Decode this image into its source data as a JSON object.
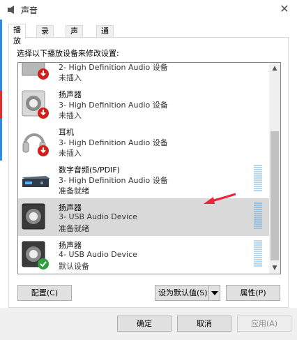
{
  "window": {
    "title": "声音"
  },
  "tabs": [
    {
      "label": "播放",
      "active": true
    },
    {
      "label": "录制",
      "active": false
    },
    {
      "label": "声音",
      "active": false
    },
    {
      "label": "通信",
      "active": false
    }
  ],
  "instruction": "选择以下播放设备来修改设置:",
  "devices": [
    {
      "name": "",
      "desc": "2- High Definition Audio 设备",
      "status": "未插入",
      "icon": "speaker-partial-icon",
      "badge": "disconnected-icon"
    },
    {
      "name": "扬声器",
      "desc": "3- High Definition Audio 设备",
      "status": "未插入",
      "icon": "speaker-icon",
      "badge": "disconnected-icon"
    },
    {
      "name": "耳机",
      "desc": "3- High Definition Audio 设备",
      "status": "未插入",
      "icon": "headphones-icon",
      "badge": "disconnected-icon"
    },
    {
      "name": "数字音频(S/PDIF)",
      "desc": "3- High Definition Audio 设备",
      "status": "准备就绪",
      "icon": "spdif-icon",
      "badge": ""
    },
    {
      "name": "扬声器",
      "desc": "3- USB Audio Device",
      "status": "准备就绪",
      "icon": "speaker-icon",
      "badge": "",
      "selected": true
    },
    {
      "name": "扬声器",
      "desc": "4- USB Audio Device",
      "status": "默认设备",
      "icon": "speaker-icon",
      "badge": "default-check-icon"
    }
  ],
  "buttons": {
    "configure": "配置(C)",
    "set_default": "设为默认值(S)",
    "properties": "属性(P)",
    "ok": "确定",
    "cancel": "取消",
    "apply": "应用(A)"
  },
  "colors": {
    "selection": "#d9d9d9",
    "annotation_arrow": "#e8233a",
    "default_badge": "#2e9e3e",
    "disconnected_badge": "#d0201c"
  }
}
